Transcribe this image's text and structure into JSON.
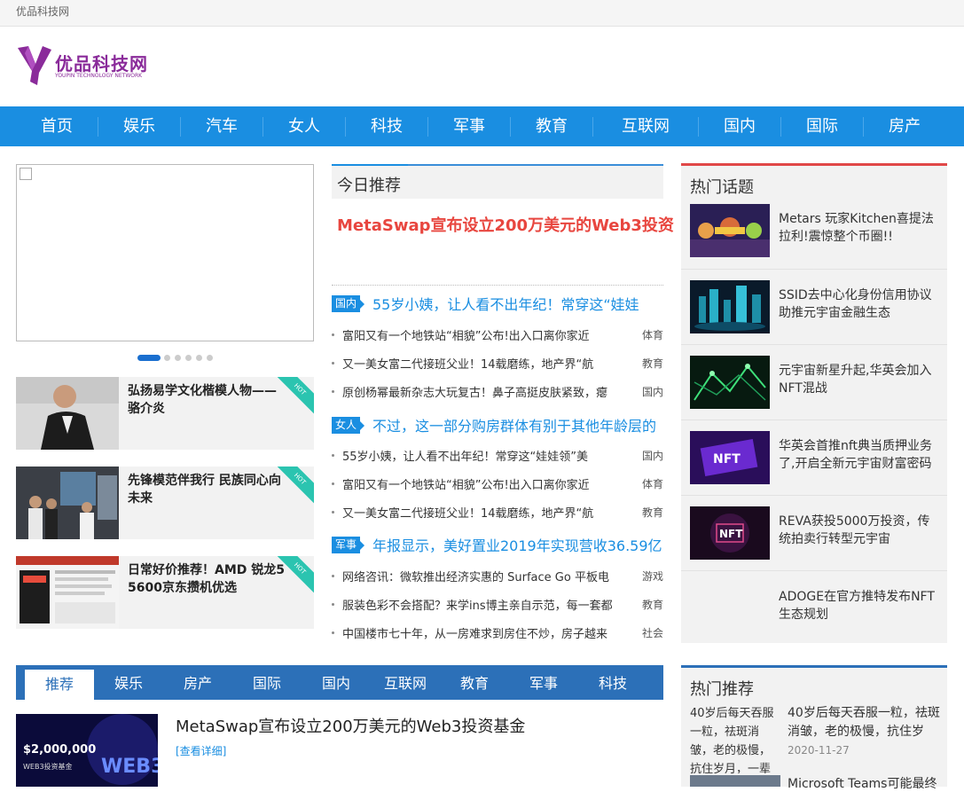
{
  "topbar": {
    "text": "优品科技网"
  },
  "logo": {
    "name": "优品科技网",
    "sub": "YOUPIN TECHNOLOGY NETWORK"
  },
  "nav": [
    "首页",
    "娱乐",
    "汽车",
    "女人",
    "科技",
    "军事",
    "教育",
    "互联网",
    "国内",
    "国际",
    "房产"
  ],
  "hot_cards": [
    {
      "title": "弘扬易学文化楷模人物——骆介炎",
      "badge": "HOT"
    },
    {
      "title": "先锋模范伴我行 民族同心向未来",
      "badge": "HOT"
    },
    {
      "title": "日常好价推荐！AMD 锐龙5 5600京东攒机优选",
      "badge": "HOT"
    }
  ],
  "today": {
    "heading": "今日推荐",
    "headline": "MetaSwap宣布设立200万美元的Web3投资",
    "sections": [
      {
        "tag": "国内",
        "title": "55岁小姨，让人看不出年纪！常穿这“娃娃",
        "items": [
          {
            "text": "富阳又有一个地铁站“相貌”公布!出入口离你家近",
            "cat": "体育"
          },
          {
            "text": "又一美女富二代接班父业！14载磨练，地产界“航",
            "cat": "教育"
          },
          {
            "text": "原创杨幂最新杂志大玩复古！鼻子高挺皮肤紧致，瘪",
            "cat": "国内"
          }
        ]
      },
      {
        "tag": "女人",
        "title": "不过，这一部分购房群体有别于其他年龄层的",
        "items": [
          {
            "text": "55岁小姨，让人看不出年纪！常穿这“娃娃领”美",
            "cat": "国内"
          },
          {
            "text": "富阳又有一个地铁站“相貌”公布!出入口离你家近",
            "cat": "体育"
          },
          {
            "text": "又一美女富二代接班父业！14载磨练，地产界“航",
            "cat": "教育"
          }
        ]
      },
      {
        "tag": "军事",
        "title": "年报显示，美好置业2019年实现营收36.59亿",
        "items": [
          {
            "text": "网络咨讯：微软推出经济实惠的 Surface Go 平板电",
            "cat": "游戏"
          },
          {
            "text": "服装色彩不会搭配？来学ins博主亲自示范，每一套都",
            "cat": "教育"
          },
          {
            "text": "中国楼市七十年，从一房难求到房住不炒，房子越来",
            "cat": "社会"
          }
        ]
      }
    ]
  },
  "hot_topics": {
    "heading": "热门话题",
    "items": [
      {
        "text": "Metars 玩家Kitchen喜提法拉利!震惊整个币圈!!",
        "thumb": "game-art"
      },
      {
        "text": "SSID去中心化身份信用协议助推元宇宙金融生态",
        "thumb": "digital-city"
      },
      {
        "text": "元宇宙新星升起,华英会加入NFT混战",
        "thumb": "neon-network"
      },
      {
        "text": "华英会首推nft典当质押业务了,开启全新元宇宙财富密码",
        "thumb": "nft-purple",
        "label": "NFT"
      },
      {
        "text": "REVA获投5000万投资，传统拍卖行转型元宇宙",
        "thumb": "nft-dark",
        "label": "NFT"
      },
      {
        "text": "ADOGE在官方推特发布NFT生态规划",
        "thumb": ""
      }
    ]
  },
  "tabs": [
    "推荐",
    "娱乐",
    "房产",
    "国际",
    "国内",
    "互联网",
    "教育",
    "军事",
    "科技"
  ],
  "article": {
    "title": "MetaSwap宣布设立200万美元的Web3投资基金",
    "more": "[查看详细]",
    "thumb_amount": "$2,000,000",
    "thumb_sub": "WEB3投资基金",
    "thumb_big": "WEB3"
  },
  "hot_recommend": {
    "heading": "热门推荐",
    "items": [
      {
        "img_alt": "40岁后每天吞服一粒，祛斑消皱，老的极慢，抗住岁月，一辈",
        "title": "40岁后每天吞服一粒，祛斑消皱，老的极慢，抗住岁",
        "date": "2020-11-27"
      },
      {
        "title": "Microsoft Teams可能最终"
      }
    ]
  },
  "colors": {
    "nav": "#1a8ee1",
    "tabs": "#2c70b8",
    "headline": "#e8463f",
    "hot_badge": "#2bc4b0",
    "logo": "#8a2b9a"
  }
}
